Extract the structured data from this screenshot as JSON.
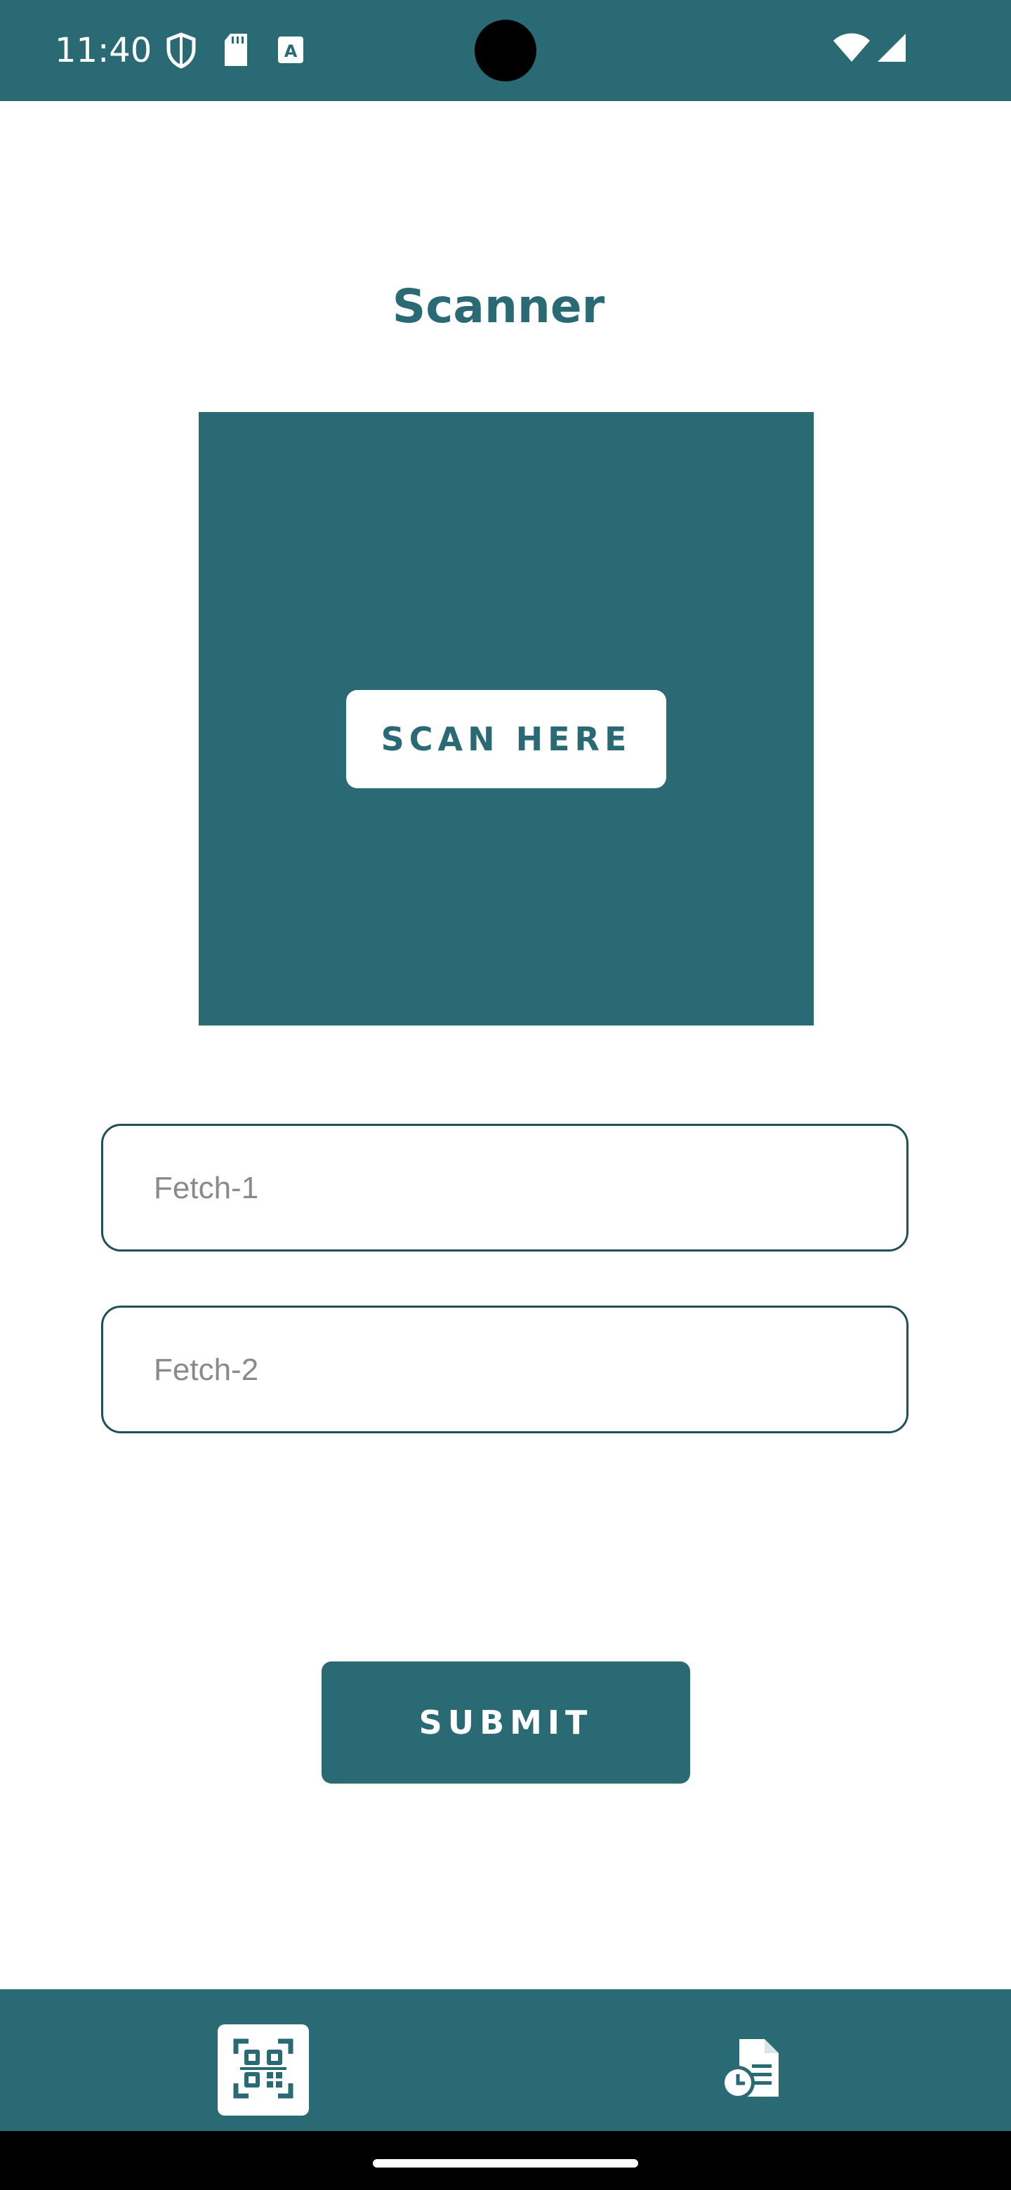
{
  "status_bar": {
    "time": "11:40",
    "icons": [
      "shield-icon",
      "sd-card-icon",
      "keyboard-a-icon",
      "wifi-icon",
      "cellular-signal-icon"
    ]
  },
  "page": {
    "title": "Scanner"
  },
  "scanner": {
    "scan_button_label": "SCAN HERE"
  },
  "form": {
    "fetch1": {
      "placeholder": "Fetch-1",
      "value": ""
    },
    "fetch2": {
      "placeholder": "Fetch-2",
      "value": ""
    },
    "submit_label": "SUBMIT"
  },
  "bottom_nav": {
    "items": [
      {
        "icon": "qr-scan-icon",
        "active": true
      },
      {
        "icon": "history-document-icon",
        "active": false
      }
    ]
  },
  "colors": {
    "primary": "#296a74",
    "background": "#ffffff",
    "border": "#1f4f57"
  }
}
